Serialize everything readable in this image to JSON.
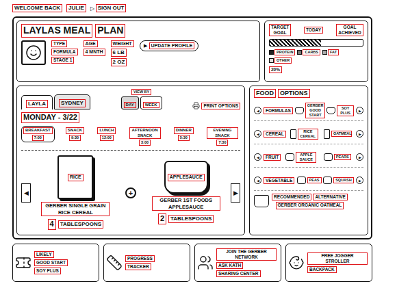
{
  "header": {
    "greeting": "WELCOME BACK",
    "user": "JULIE",
    "signout_icon": "▷",
    "signout": "SIGN OUT"
  },
  "plan": {
    "title": "LAYLAS MEAL",
    "title2": "PLAN"
  },
  "profile": {
    "fields": [
      "TYPE",
      "FORMULA",
      "STAGE 1"
    ],
    "age_label": "AGE",
    "age": "4 MNTH",
    "weight_label": "WEIGHT",
    "weight": [
      "6 LB",
      "2 OZ"
    ],
    "button_icon": "▶",
    "button": "UPDATE PROFILE"
  },
  "goal": {
    "target": "TARGET GOAL",
    "today": "TODAY",
    "achieved": "GOAL ACHIEVED",
    "level": 0.55,
    "percent": "20%",
    "legend": [
      {
        "label": "PROTEIN",
        "color": "#222222"
      },
      {
        "label": "CARBS",
        "color": "#777777"
      },
      {
        "label": "FAT",
        "color": "#aaaaaa"
      },
      {
        "label": "OTHER",
        "color": "#dddddd"
      }
    ]
  },
  "people": [
    {
      "label": "LAYLA",
      "selected": true
    },
    {
      "label": "SYDNEY",
      "selected": false
    }
  ],
  "view": {
    "label": "VIEW BY",
    "options": [
      {
        "label": "DAY",
        "selected": true
      },
      {
        "label": "WEEK",
        "selected": false
      }
    ]
  },
  "print": "PRINT OPTIONS",
  "date": "MONDAY - 3/22",
  "meals": [
    {
      "label": "BREAKFAST",
      "time": "7:00",
      "selected": true
    },
    {
      "label": "SNACK",
      "time": "9:30",
      "selected": false
    },
    {
      "label": "LUNCH",
      "time": "12:00",
      "selected": false
    },
    {
      "label": "AFTERNOON SNACK",
      "time": "3:00",
      "selected": false
    },
    {
      "label": "DINNER",
      "time": "5:30",
      "selected": false
    },
    {
      "label": "EVENING SNACK",
      "time": "7:30",
      "selected": false
    }
  ],
  "nav": {
    "prev": "◀",
    "next": "▶",
    "plus": "+"
  },
  "foods": [
    {
      "package": "RICE",
      "name": "GERBER SINGLE GRAIN RICE CEREAL",
      "amount": "4",
      "unit": "TABLESPOONS",
      "kind": "box"
    },
    {
      "package": "APPLESAUCE",
      "name": "GERBER 1ST FOODS APPLESAUCE",
      "amount": "2",
      "unit": "TABLESPOONS",
      "kind": "jar"
    }
  ],
  "food_options": {
    "title": "FOOD",
    "title2": "OPTIONS",
    "categories": [
      {
        "label": "FORMULAS",
        "items": [
          {
            "name": "GERBER GOOD START",
            "kind": "tub"
          },
          {
            "name": "SOY PLUS",
            "kind": "tub"
          }
        ]
      },
      {
        "label": "CEREAL",
        "items": [
          {
            "name": "RICE CEREAL",
            "kind": "box"
          },
          {
            "name": "OATMEAL",
            "kind": "box"
          }
        ]
      },
      {
        "label": "FRUIT",
        "items": [
          {
            "name": "APPLE SAUCE",
            "kind": "jar"
          },
          {
            "name": "PEARS",
            "kind": "jar"
          }
        ]
      },
      {
        "label": "VEGETABLE",
        "items": [
          {
            "name": "PEAS",
            "kind": "jar"
          },
          {
            "name": "SQUASH",
            "kind": "jar"
          }
        ]
      }
    ],
    "recommended": {
      "label": "RECOMMENDED",
      "label2": "ALTERNATIVE",
      "name": "GERBER ORGANIC OATMEAL"
    }
  },
  "promos": [
    {
      "kind": "coupon",
      "lines": [
        "LIKELY",
        "GOOD START",
        "SOY PLUS"
      ]
    },
    {
      "kind": "tape",
      "lines": [
        "PROGRESS",
        "TRACKER"
      ]
    },
    {
      "kind": "network",
      "lines": [
        "JOIN THE GERBER NETWORK",
        "ASK KATH",
        "SHARING CENTER"
      ]
    },
    {
      "kind": "stroller",
      "lines": [
        "FREE JOGGER STROLLER",
        "BACKPACK"
      ]
    }
  ]
}
